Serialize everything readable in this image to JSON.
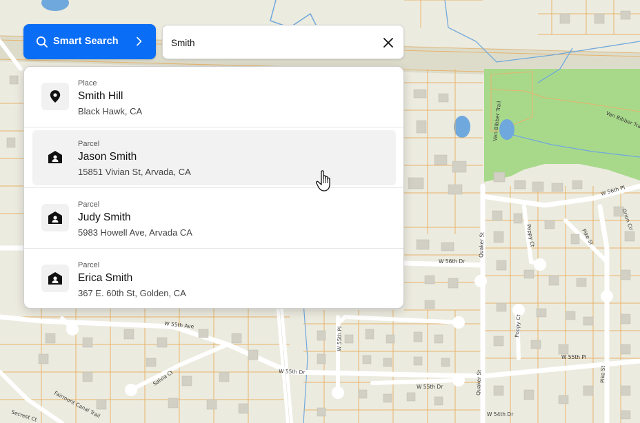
{
  "smart_search": {
    "label": "Smart Search",
    "icon": "search-icon",
    "chevron_icon": "chevron-right-icon"
  },
  "search": {
    "value": "Smith",
    "clear_icon": "close-icon"
  },
  "results": [
    {
      "type": "Place",
      "title": "Smith Hill",
      "subtitle": "Black Hawk, CA",
      "icon": "map-pin-icon"
    },
    {
      "type": "Parcel",
      "title": "Jason Smith",
      "subtitle": "15851 Vivian St, Arvada, CA",
      "icon": "house-person-icon"
    },
    {
      "type": "Parcel",
      "title": "Judy Smith",
      "subtitle": "5983 Howell Ave, Arvada CA",
      "icon": "house-person-icon"
    },
    {
      "type": "Parcel",
      "title": "Erica Smith",
      "subtitle": "367 E. 60th St, Golden, CA",
      "icon": "house-person-icon"
    }
  ],
  "map": {
    "labels": {
      "van_bibber_trail_v": "Van Bibber Trail",
      "van_bibber_trail": "Van Bibber Trail",
      "w_56th_pl": "W 56th Pl",
      "orion_cir": "Orion Cir",
      "poppy_ct_n": "Poppy Ct",
      "pike_st_n": "Pike St",
      "quaker_st_n": "Quaker St",
      "w_56th_dr": "W 56th Dr",
      "w_55th_pl_w": "W 55th Pl",
      "w_55th_ave": "W 55th Ave",
      "poppy_ct_s": "Poppy Ct",
      "salvia_ct": "Salvia Ct",
      "w_55th_dr": "W 55th Dr",
      "w_55th_dr_e": "W 55th Dr",
      "w_55th_pl_e": "W 55th Pl",
      "quaker_st_s": "Quaker St",
      "pike_st_s": "Pike St",
      "fairmont_canal_trail": "Fairmont Canal Trail",
      "secrest_ct": "Secrest Ct",
      "w_54th_dr": "W 54th Dr"
    },
    "colors": {
      "background": "#ECEBDF",
      "park": "#A8D98B",
      "water": "#6FA8DC",
      "parcel_line": "#E7B36B",
      "road": "#FFFFFF",
      "building": "#D2D0C5"
    }
  },
  "accent_color": "#0A6DF5"
}
